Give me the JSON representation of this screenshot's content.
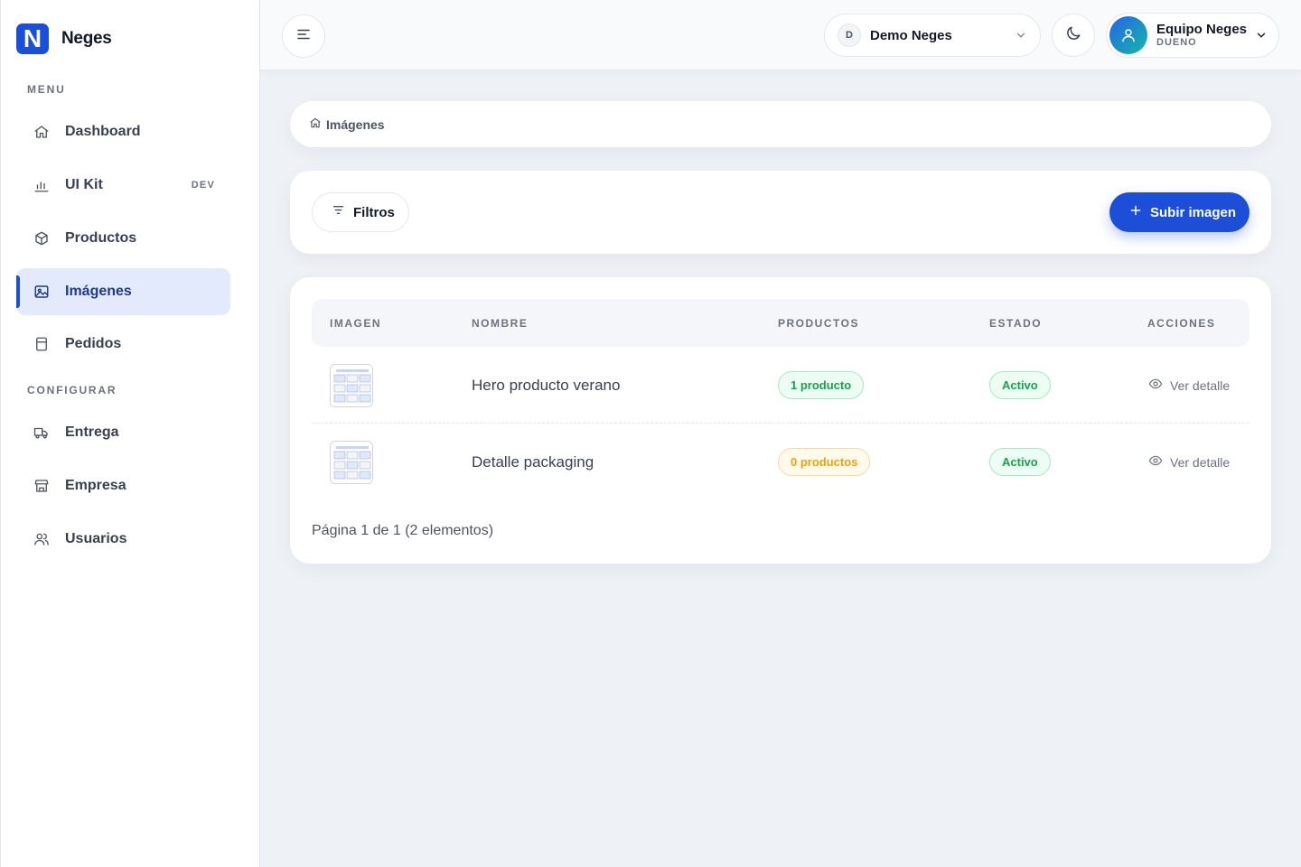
{
  "brand": {
    "logo_letter": "N",
    "name": "Neges",
    "color": "#1a4fd8"
  },
  "sidebar": {
    "sections": [
      {
        "label": "MENU"
      },
      {
        "label": "CONFIGURAR"
      }
    ],
    "items": [
      {
        "label": "Dashboard",
        "icon": "home-icon"
      },
      {
        "label": "UI Kit",
        "icon": "bar-chart-icon",
        "tag": "DEV"
      },
      {
        "label": "Productos",
        "icon": "box-icon"
      },
      {
        "label": "Imágenes",
        "icon": "image-icon",
        "active": true
      },
      {
        "label": "Pedidos",
        "icon": "receipt-icon"
      },
      {
        "label": "Entrega",
        "icon": "truck-icon"
      },
      {
        "label": "Empresa",
        "icon": "store-icon"
      },
      {
        "label": "Usuarios",
        "icon": "users-icon"
      }
    ]
  },
  "topbar": {
    "menu_icon": "menu-icon",
    "org": {
      "initial": "D",
      "name": "Demo Neges"
    },
    "theme_icon": "moon-icon",
    "user": {
      "name": "Equipo Neges",
      "role": "DUENO"
    }
  },
  "breadcrumb": {
    "icon": "home-icon",
    "label": "Imágenes"
  },
  "toolbar": {
    "filter_label": "Filtros",
    "upload_label": "Subir imagen"
  },
  "table": {
    "headers": [
      "IMAGEN",
      "NOMBRE",
      "PRODUCTOS",
      "ESTADO",
      "ACCIONES"
    ],
    "rows": [
      {
        "name": "Hero producto verano",
        "products": "1 producto",
        "products_status": "green",
        "status": "Activo",
        "action": "Ver detalle"
      },
      {
        "name": "Detalle packaging",
        "products": "0 productos",
        "products_status": "amber",
        "status": "Activo",
        "action": "Ver detalle"
      }
    ],
    "pagination": "Página 1 de 1 (2 elementos)"
  },
  "colors": {
    "primary": "#1d4ed8",
    "success": "#16a34a",
    "warning": "#f59e0b",
    "active_nav_bg": "#e3eafb"
  }
}
